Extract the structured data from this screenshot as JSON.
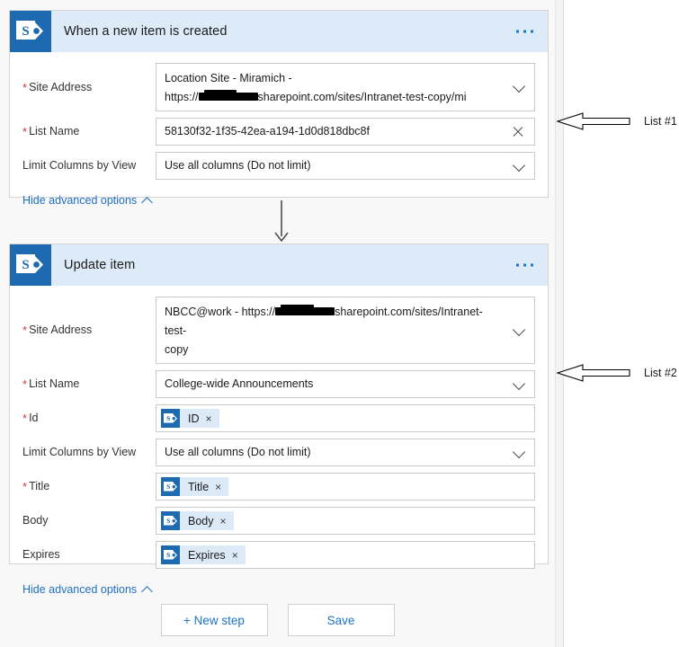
{
  "cards": [
    {
      "id": "trigger",
      "icon": "sharepoint-icon",
      "title": "When a new item is created",
      "overflow_label": "•••",
      "fields": [
        {
          "label": "Site Address",
          "required": true,
          "value_line1": "Location Site - Miramich -",
          "value_line2_prefix": "https://",
          "value_line2_suffix": "sharepoint.com/sites/Intranet-test-copy/mi",
          "redacted": true,
          "control": "dropdown",
          "icon": "chevron-down-icon",
          "two_line": true
        },
        {
          "label": "List Name",
          "required": true,
          "value": "58130f32-1f35-42ea-a194-1d0d818dbc8f",
          "control": "clearable",
          "icon": "clear-x-icon"
        },
        {
          "label": "Limit Columns by View",
          "required": false,
          "value": "Use all columns (Do not limit)",
          "control": "dropdown",
          "icon": "chevron-down-icon"
        }
      ],
      "advanced_link": "Hide advanced options"
    },
    {
      "id": "action",
      "icon": "sharepoint-icon",
      "title": "Update item",
      "overflow_label": "•••",
      "fields": [
        {
          "label": "Site Address",
          "required": true,
          "value_line1_prefix": "NBCC@work - https://",
          "value_line1_suffix": "sharepoint.com/sites/Intranet-test-",
          "value_line2": "copy",
          "redacted": true,
          "control": "dropdown",
          "icon": "chevron-down-icon",
          "two_line": true
        },
        {
          "label": "List Name",
          "required": true,
          "value": "College-wide Announcements",
          "control": "dropdown",
          "icon": "chevron-down-icon"
        },
        {
          "label": "Id",
          "required": true,
          "token": "ID",
          "token_icon": "sharepoint-icon",
          "token_remove": "×",
          "control": "token"
        },
        {
          "label": "Limit Columns by View",
          "required": false,
          "value": "Use all columns (Do not limit)",
          "control": "dropdown",
          "icon": "chevron-down-icon"
        },
        {
          "label": "Title",
          "required": true,
          "token": "Title",
          "token_icon": "sharepoint-icon",
          "token_remove": "×",
          "control": "token"
        },
        {
          "label": "Body",
          "required": false,
          "token": "Body",
          "token_icon": "sharepoint-icon",
          "token_remove": "×",
          "control": "token"
        },
        {
          "label": "Expires",
          "required": false,
          "token": "Expires",
          "token_icon": "sharepoint-icon",
          "token_remove": "×",
          "control": "token"
        }
      ],
      "advanced_link": "Hide advanced options"
    }
  ],
  "connector": {
    "icon": "down-arrow-connector-icon"
  },
  "action_bar": {
    "new_step_label": "+ New step",
    "save_label": "Save"
  },
  "annotations": [
    {
      "icon": "left-block-arrow-icon",
      "label": "List #1"
    },
    {
      "icon": "left-block-arrow-icon",
      "label": "List #2"
    }
  ],
  "colors": {
    "sharepoint_blue": "#1e6ab0",
    "card_header_blue": "#dcebf7",
    "link_blue": "#1f74c4",
    "required_red": "#d6373a",
    "canvas_gray": "#f8f8f8",
    "token_blue": "#dce9f6"
  }
}
